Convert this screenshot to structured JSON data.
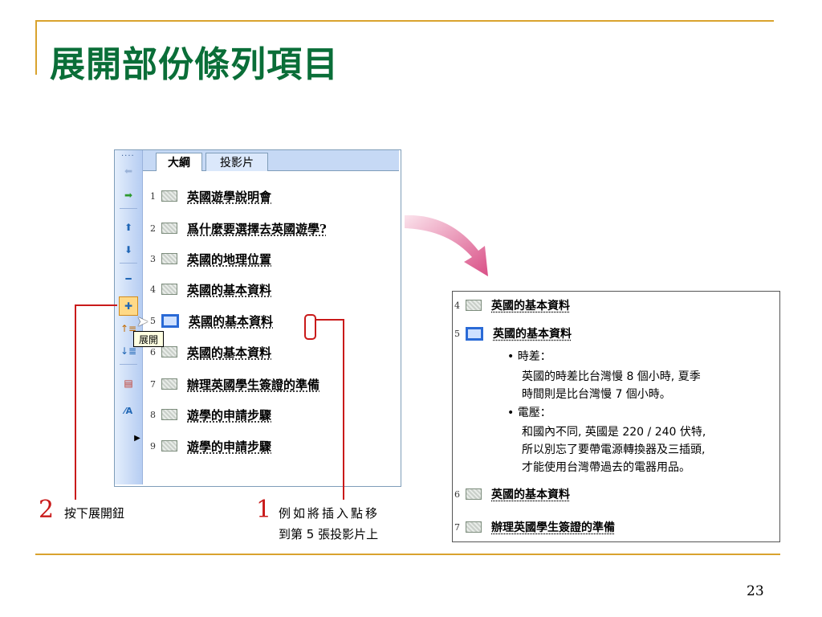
{
  "slide": {
    "title": "展開部份條列項目",
    "page_number": "23"
  },
  "outline_pane": {
    "tabs": [
      "大綱",
      "投影片"
    ],
    "toolbar_dots": "····",
    "tooltip": "展開",
    "rows": [
      {
        "num": "1",
        "text": "英國遊學說明會"
      },
      {
        "num": "2",
        "text": "爲什麼要選擇去英國遊學?"
      },
      {
        "num": "3",
        "text": "英國的地理位置"
      },
      {
        "num": "4",
        "text": "英國的基本資料"
      },
      {
        "num": "5",
        "text": "英國的基本資料"
      },
      {
        "num": "6",
        "text": "英國的基本資料"
      },
      {
        "num": "7",
        "text": "辦理英國學生簽證的準備"
      },
      {
        "num": "8",
        "text": "遊學的申請步驟"
      },
      {
        "num": "9",
        "text": "遊學的申請步驟"
      }
    ],
    "toolbar_icons": [
      "promote-icon",
      "demote-icon",
      "move-up-icon",
      "move-down-icon",
      "collapse-icon",
      "expand-icon",
      "collapse-all-icon",
      "expand-all-icon",
      "summary-slide-icon",
      "show-formatting-icon",
      "more-icon"
    ]
  },
  "callouts": {
    "step2_num": "2",
    "step2_text": "按下展開鈕",
    "step1_num": "1",
    "step1_line1": "例如將插入點移",
    "step1_line2": "到第 5 張投影片上"
  },
  "result_panel": {
    "rows_before": [
      {
        "num": "4",
        "text": "英國的基本資料"
      },
      {
        "num": "5",
        "text": "英國的基本資料"
      }
    ],
    "bullets": [
      {
        "head": "時差：",
        "lines": [
          "英國的時差比台灣慢 8 個小時, 夏季",
          "時間則是比台灣慢 7 個小時。"
        ]
      },
      {
        "head": "電壓：",
        "lines": [
          "和國內不同, 英國是 220 / 240 伏特,",
          "所以別忘了要帶電源轉換器及三插頭,",
          "才能使用台灣帶過去的電器用品。"
        ]
      }
    ],
    "rows_after": [
      {
        "num": "6",
        "text": "英國的基本資料"
      },
      {
        "num": "7",
        "text": "辦理英國學生簽證的準備"
      }
    ]
  },
  "colors": {
    "title": "#0a6e38",
    "accent_rule": "#d9a32e",
    "callout_red": "#c91a1a",
    "selection_blue": "#2a6ad6"
  }
}
